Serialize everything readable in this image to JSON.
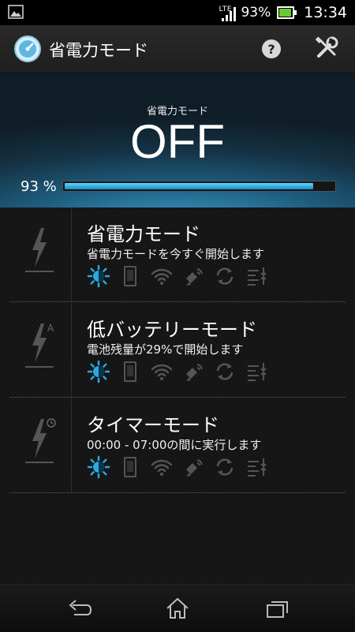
{
  "status_bar": {
    "network": "LTE",
    "battery_percent": "93%",
    "time": "13:34",
    "battery_color": "#66cc33"
  },
  "header": {
    "title": "省電力モード",
    "help_icon": "help-icon",
    "tools_icon": "wrench-screwdriver-icon"
  },
  "hero": {
    "label": "省電力モード",
    "state": "OFF",
    "battery_text": "93 %",
    "battery_level": 0.93,
    "accent_color": "#29a9e0"
  },
  "modes": [
    {
      "title": "省電力モード",
      "description": "省電力モードを今すぐ開始します",
      "icon": "lightning-icon"
    },
    {
      "title": "低バッテリーモード",
      "description": "電池残量が29%で開始します",
      "icon": "lightning-auto-icon"
    },
    {
      "title": "タイマーモード",
      "description": "00:00 - 07:00の間に実行します",
      "icon": "lightning-timer-icon"
    }
  ],
  "feature_icons": [
    "brightness-icon",
    "screen-icon",
    "wifi-icon",
    "gps-icon",
    "sync-icon",
    "data-sync-icon"
  ],
  "nav": [
    "back-icon",
    "home-icon",
    "recent-apps-icon"
  ]
}
